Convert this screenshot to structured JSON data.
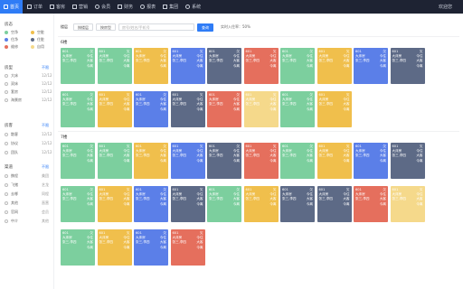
{
  "nav": {
    "items": [
      {
        "label": "首页",
        "icon": "home-icon"
      },
      {
        "label": "订单",
        "icon": "order-icon"
      },
      {
        "label": "客房",
        "icon": "room-icon"
      },
      {
        "label": "营销",
        "icon": "marketing-icon"
      },
      {
        "label": "会员",
        "icon": "member-icon"
      },
      {
        "label": "财务",
        "icon": "finance-icon"
      },
      {
        "label": "报表",
        "icon": "report-icon"
      },
      {
        "label": "集团",
        "icon": "group-icon"
      },
      {
        "label": "系统",
        "icon": "system-icon"
      }
    ],
    "user": "欢迎您"
  },
  "sidebar": {
    "status_title": "房态",
    "status": [
      {
        "label": "空净",
        "color": "#7ccf9e"
      },
      {
        "label": "空脏",
        "color": "#f0bf4c"
      },
      {
        "label": "住净",
        "color": "#5b7fe8"
      },
      {
        "label": "住脏",
        "color": "#5d6a86"
      },
      {
        "label": "维修",
        "color": "#e56f5d"
      },
      {
        "label": "自用",
        "color": "#f5d98b"
      }
    ],
    "roomtype_title": "房型",
    "roomtype_link": "不限",
    "roomtypes": [
      {
        "label": "大床",
        "count": "12/12"
      },
      {
        "label": "双床",
        "count": "12/12"
      },
      {
        "label": "套房",
        "count": "12/12"
      },
      {
        "label": "海景房",
        "count": "12/12"
      }
    ],
    "type_title": "房客",
    "type_link": "不限",
    "types": [
      {
        "label": "散客",
        "count": "12/12"
      },
      {
        "label": "协议",
        "count": "12/12"
      },
      {
        "label": "团队",
        "count": "12/12"
      }
    ],
    "channel_title": "渠道",
    "channel_link": "不限",
    "channels": [
      {
        "label": "携程",
        "count": "美团"
      },
      {
        "label": "飞猪",
        "count": "艺龙"
      },
      {
        "label": "去哪",
        "count": "同程"
      },
      {
        "label": "其他",
        "count": "直营"
      },
      {
        "label": "官网",
        "count": "会员"
      },
      {
        "label": "中介",
        "count": "其他"
      }
    ]
  },
  "toolbar": {
    "label": "楼层",
    "btn1": "按楼层",
    "btn2": "按房型",
    "search_placeholder": "房号/姓名/手机号",
    "search_btn": "查询",
    "occupancy": "实时入住率：50%"
  },
  "floors": [
    {
      "title": "6楼",
      "rooms": [
        {
          "no": "601",
          "type": "大床房",
          "guest": "张三,李四",
          "s1": "欠",
          "s2": "今住",
          "s3": "大客",
          "s4": "今离",
          "status": "green"
        },
        {
          "no": "601",
          "type": "大床房",
          "guest": "张三,李四",
          "s1": "欠",
          "s2": "今住",
          "s3": "大客",
          "s4": "今离",
          "status": "green"
        },
        {
          "no": "601",
          "type": "大床房",
          "guest": "张三,李四",
          "s1": "欠",
          "s2": "今住",
          "s3": "大客",
          "s4": "今离",
          "status": "yellow"
        },
        {
          "no": "601",
          "type": "大床房",
          "guest": "张三,李四",
          "s1": "欠",
          "s2": "今住",
          "s3": "大客",
          "s4": "今离",
          "status": "blue"
        },
        {
          "no": "601",
          "type": "大床房",
          "guest": "张三,李四",
          "s1": "欠",
          "s2": "今住",
          "s3": "大客",
          "s4": "今离",
          "status": "navy"
        },
        {
          "no": "601",
          "type": "大床房",
          "guest": "张三,李四",
          "s1": "欠",
          "s2": "今住",
          "s3": "大客",
          "s4": "今离",
          "status": "red"
        },
        {
          "no": "601",
          "type": "大床房",
          "guest": "张三,李四",
          "s1": "欠",
          "s2": "今住",
          "s3": "大客",
          "s4": "今离",
          "status": "green"
        },
        {
          "no": "601",
          "type": "大床房",
          "guest": "张三,李四",
          "s1": "欠",
          "s2": "今住",
          "s3": "大客",
          "s4": "今离",
          "status": "yellow"
        },
        {
          "no": "601",
          "type": "大床房",
          "guest": "张三,李四",
          "s1": "欠",
          "s2": "今住",
          "s3": "大客",
          "s4": "今离",
          "status": "blue"
        },
        {
          "no": "601",
          "type": "大床房",
          "guest": "张三,李四",
          "s1": "欠",
          "s2": "今住",
          "s3": "大客",
          "s4": "今离",
          "status": "navy"
        },
        {
          "no": "601",
          "type": "大床房",
          "guest": "张三,李四",
          "s1": "欠",
          "s2": "今住",
          "s3": "大客",
          "s4": "今离",
          "status": "green"
        },
        {
          "no": "601",
          "type": "大床房",
          "guest": "张三,李四",
          "s1": "欠",
          "s2": "今住",
          "s3": "大客",
          "s4": "今离",
          "status": "yellow"
        },
        {
          "no": "601",
          "type": "大床房",
          "guest": "张三,李四",
          "s1": "欠",
          "s2": "今住",
          "s3": "大客",
          "s4": "今离",
          "status": "blue"
        },
        {
          "no": "601",
          "type": "大床房",
          "guest": "张三,李四",
          "s1": "欠",
          "s2": "今住",
          "s3": "大客",
          "s4": "今离",
          "status": "navy"
        },
        {
          "no": "601",
          "type": "大床房",
          "guest": "张三,李四",
          "s1": "欠",
          "s2": "今住",
          "s3": "大客",
          "s4": "今离",
          "status": "red"
        },
        {
          "no": "601",
          "type": "大床房",
          "guest": "张三,李四",
          "s1": "欠",
          "s2": "今住",
          "s3": "大客",
          "s4": "今离",
          "status": "lyellow"
        },
        {
          "no": "601",
          "type": "大床房",
          "guest": "张三,李四",
          "s1": "欠",
          "s2": "今住",
          "s3": "大客",
          "s4": "今离",
          "status": "green"
        },
        {
          "no": "601",
          "type": "大床房",
          "guest": "张三,李四",
          "s1": "欠",
          "s2": "今住",
          "s3": "大客",
          "s4": "今离",
          "status": "yellow"
        }
      ]
    },
    {
      "title": "7楼",
      "rooms": [
        {
          "no": "601",
          "type": "大床房",
          "guest": "张三,李四",
          "s1": "欠",
          "s2": "今住",
          "s3": "大客",
          "s4": "今离",
          "status": "green"
        },
        {
          "no": "601",
          "type": "大床房",
          "guest": "张三,李四",
          "s1": "欠",
          "s2": "今住",
          "s3": "大客",
          "s4": "今离",
          "status": "green"
        },
        {
          "no": "601",
          "type": "大床房",
          "guest": "张三,李四",
          "s1": "欠",
          "s2": "今住",
          "s3": "大客",
          "s4": "今离",
          "status": "yellow"
        },
        {
          "no": "601",
          "type": "大床房",
          "guest": "张三,李四",
          "s1": "欠",
          "s2": "今住",
          "s3": "大客",
          "s4": "今离",
          "status": "blue"
        },
        {
          "no": "601",
          "type": "大床房",
          "guest": "张三,李四",
          "s1": "欠",
          "s2": "今住",
          "s3": "大客",
          "s4": "今离",
          "status": "navy"
        },
        {
          "no": "601",
          "type": "大床房",
          "guest": "张三,李四",
          "s1": "欠",
          "s2": "今住",
          "s3": "大客",
          "s4": "今离",
          "status": "red"
        },
        {
          "no": "601",
          "type": "大床房",
          "guest": "张三,李四",
          "s1": "欠",
          "s2": "今住",
          "s3": "大客",
          "s4": "今离",
          "status": "green"
        },
        {
          "no": "601",
          "type": "大床房",
          "guest": "张三,李四",
          "s1": "欠",
          "s2": "今住",
          "s3": "大客",
          "s4": "今离",
          "status": "yellow"
        },
        {
          "no": "601",
          "type": "大床房",
          "guest": "张三,李四",
          "s1": "欠",
          "s2": "今住",
          "s3": "大客",
          "s4": "今离",
          "status": "blue"
        },
        {
          "no": "601",
          "type": "大床房",
          "guest": "张三,李四",
          "s1": "欠",
          "s2": "今住",
          "s3": "大客",
          "s4": "今离",
          "status": "navy"
        },
        {
          "no": "601",
          "type": "大床房",
          "guest": "张三,李四",
          "s1": "欠",
          "s2": "今住",
          "s3": "大客",
          "s4": "今离",
          "status": "green"
        },
        {
          "no": "601",
          "type": "大床房",
          "guest": "张三,李四",
          "s1": "欠",
          "s2": "今住",
          "s3": "大客",
          "s4": "今离",
          "status": "yellow"
        },
        {
          "no": "601",
          "type": "大床房",
          "guest": "张三,李四",
          "s1": "欠",
          "s2": "今住",
          "s3": "大客",
          "s4": "今离",
          "status": "blue"
        },
        {
          "no": "601",
          "type": "大床房",
          "guest": "张三,李四",
          "s1": "欠",
          "s2": "今住",
          "s3": "大客",
          "s4": "今离",
          "status": "navy"
        },
        {
          "no": "601",
          "type": "大床房",
          "guest": "张三,李四",
          "s1": "欠",
          "s2": "今住",
          "s3": "大客",
          "s4": "今离",
          "status": "green"
        },
        {
          "no": "601",
          "type": "大床房",
          "guest": "张三,李四",
          "s1": "欠",
          "s2": "今住",
          "s3": "大客",
          "s4": "今离",
          "status": "yellow"
        },
        {
          "no": "601",
          "type": "大床房",
          "guest": "张三,李四",
          "s1": "欠",
          "s2": "今住",
          "s3": "大客",
          "s4": "今离",
          "status": "navy"
        },
        {
          "no": "601",
          "type": "大床房",
          "guest": "张三,李四",
          "s1": "欠",
          "s2": "今住",
          "s3": "大客",
          "s4": "今离",
          "status": "navy"
        },
        {
          "no": "601",
          "type": "大床房",
          "guest": "张三,李四",
          "s1": "欠",
          "s2": "今住",
          "s3": "大客",
          "s4": "今离",
          "status": "red"
        },
        {
          "no": "601",
          "type": "大床房",
          "guest": "张三,李四",
          "s1": "欠",
          "s2": "今住",
          "s3": "大客",
          "s4": "今离",
          "status": "lyellow"
        },
        {
          "no": "601",
          "type": "大床房",
          "guest": "张三,李四",
          "s1": "欠",
          "s2": "今住",
          "s3": "大客",
          "s4": "今离",
          "status": "green"
        },
        {
          "no": "601",
          "type": "大床房",
          "guest": "张三,李四",
          "s1": "欠",
          "s2": "今住",
          "s3": "大客",
          "s4": "今离",
          "status": "yellow"
        },
        {
          "no": "601",
          "type": "大床房",
          "guest": "张三,李四",
          "s1": "欠",
          "s2": "今住",
          "s3": "大客",
          "s4": "今离",
          "status": "blue"
        },
        {
          "no": "601",
          "type": "大床房",
          "guest": "张三,李四",
          "s1": "欠",
          "s2": "今住",
          "s3": "大客",
          "s4": "今离",
          "status": "red"
        }
      ]
    }
  ]
}
